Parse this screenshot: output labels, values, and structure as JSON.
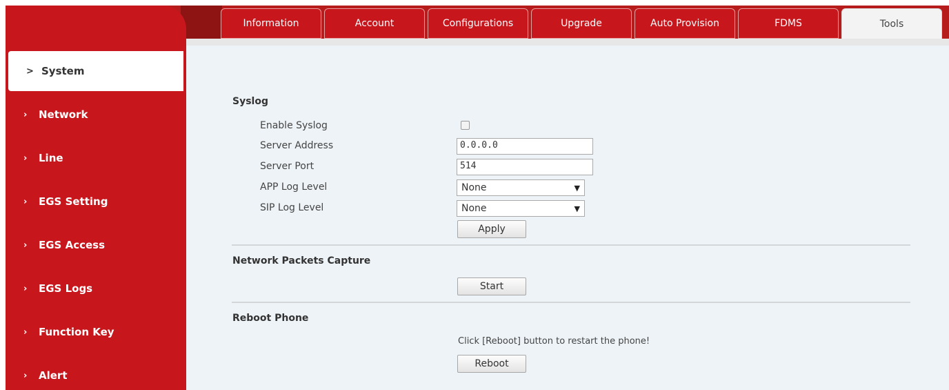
{
  "tabs": [
    {
      "label": "Information"
    },
    {
      "label": "Account"
    },
    {
      "label": "Configurations"
    },
    {
      "label": "Upgrade"
    },
    {
      "label": "Auto Provision"
    },
    {
      "label": "FDMS"
    },
    {
      "label": "Tools"
    }
  ],
  "active_tab": "Tools",
  "sidebar": {
    "items": [
      {
        "label": "System",
        "chevron": ">"
      },
      {
        "label": "Network",
        "chevron": "›"
      },
      {
        "label": "Line",
        "chevron": "›"
      },
      {
        "label": "EGS Setting",
        "chevron": "›"
      },
      {
        "label": "EGS Access",
        "chevron": "›"
      },
      {
        "label": "EGS Logs",
        "chevron": "›"
      },
      {
        "label": "Function Key",
        "chevron": "›"
      },
      {
        "label": "Alert",
        "chevron": "›"
      }
    ],
    "active_item": "System"
  },
  "syslog": {
    "title": "Syslog",
    "enable_label": "Enable Syslog",
    "enable_checked": false,
    "server_address_label": "Server Address",
    "server_address_value": "0.0.0.0",
    "server_port_label": "Server Port",
    "server_port_value": "514",
    "app_log_level_label": "APP Log Level",
    "app_log_level_value": "None",
    "sip_log_level_label": "SIP Log Level",
    "sip_log_level_value": "None",
    "apply_label": "Apply"
  },
  "capture": {
    "title": "Network Packets Capture",
    "start_label": "Start"
  },
  "reboot": {
    "title": "Reboot Phone",
    "hint": "Click [Reboot] button to restart the phone!",
    "reboot_label": "Reboot"
  },
  "colors": {
    "brand_red": "#c8161d",
    "content_bg": "#eef3f7"
  },
  "icons": {
    "dropdown": "dropdown-arrow-icon",
    "chevron": "chevron-right-icon"
  }
}
